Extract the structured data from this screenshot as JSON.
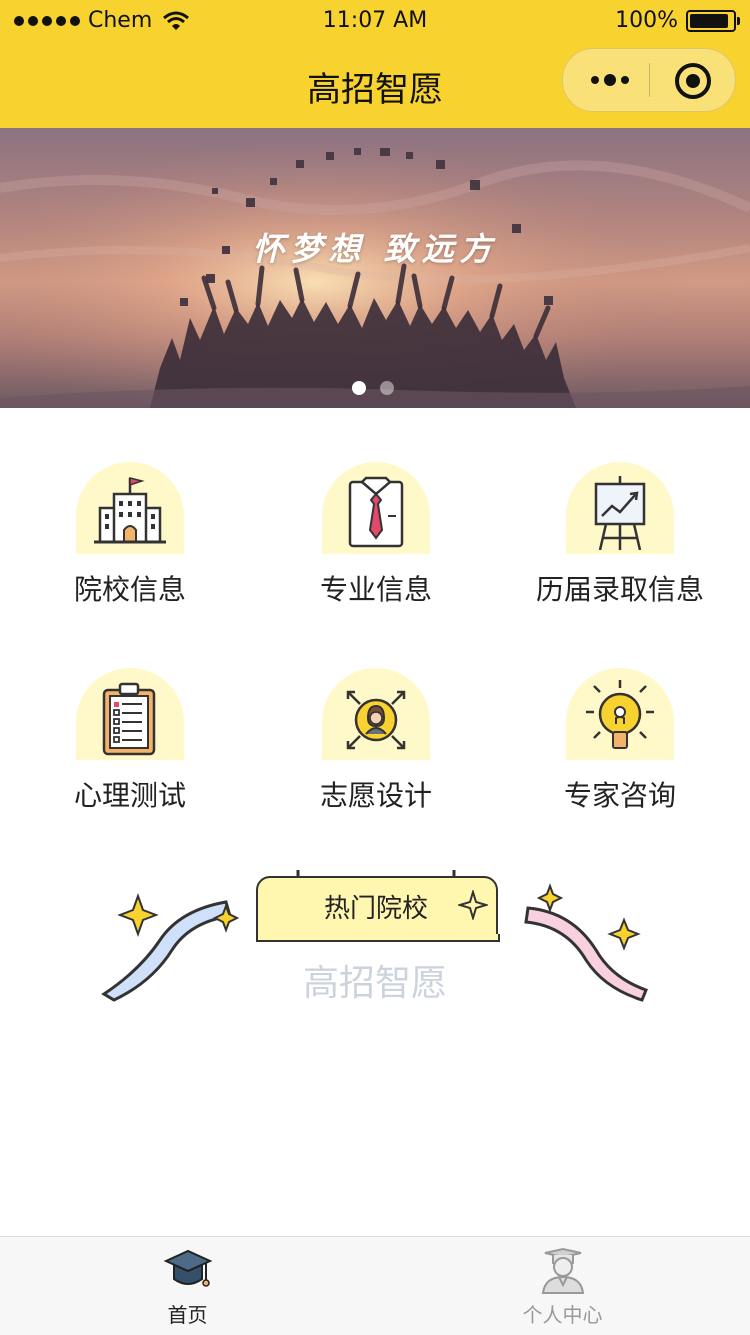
{
  "status_bar": {
    "carrier": "Chem",
    "time": "11:07 AM",
    "battery": "100%",
    "battery_level": 1.0
  },
  "nav": {
    "title": "高招智愿",
    "more_icon": "more-dots-icon",
    "close_icon": "close-target-icon"
  },
  "banner": {
    "slogan": "怀梦想 致远方",
    "slide_count": 2,
    "active_slide": 1
  },
  "menu": {
    "items": [
      {
        "label": "院校信息",
        "icon": "university-icon"
      },
      {
        "label": "专业信息",
        "icon": "shirt-tie-icon"
      },
      {
        "label": "历届录取信息",
        "icon": "chart-easel-icon"
      },
      {
        "label": "心理测试",
        "icon": "clipboard-test-icon"
      },
      {
        "label": "志愿设计",
        "icon": "person-arrows-icon"
      },
      {
        "label": "专家咨询",
        "icon": "lightbulb-icon"
      }
    ]
  },
  "hot": {
    "title": "热门院校",
    "subtitle": "高招智愿"
  },
  "tabbar": {
    "tabs": [
      {
        "label": "首页",
        "icon": "graduation-cap-icon",
        "active": true
      },
      {
        "label": "个人中心",
        "icon": "graduate-person-icon",
        "active": false
      }
    ]
  },
  "colors": {
    "brand_yellow": "#f8d22f",
    "icon_bg": "#fff8c9",
    "subtitle_gray": "#cdd3dc"
  }
}
